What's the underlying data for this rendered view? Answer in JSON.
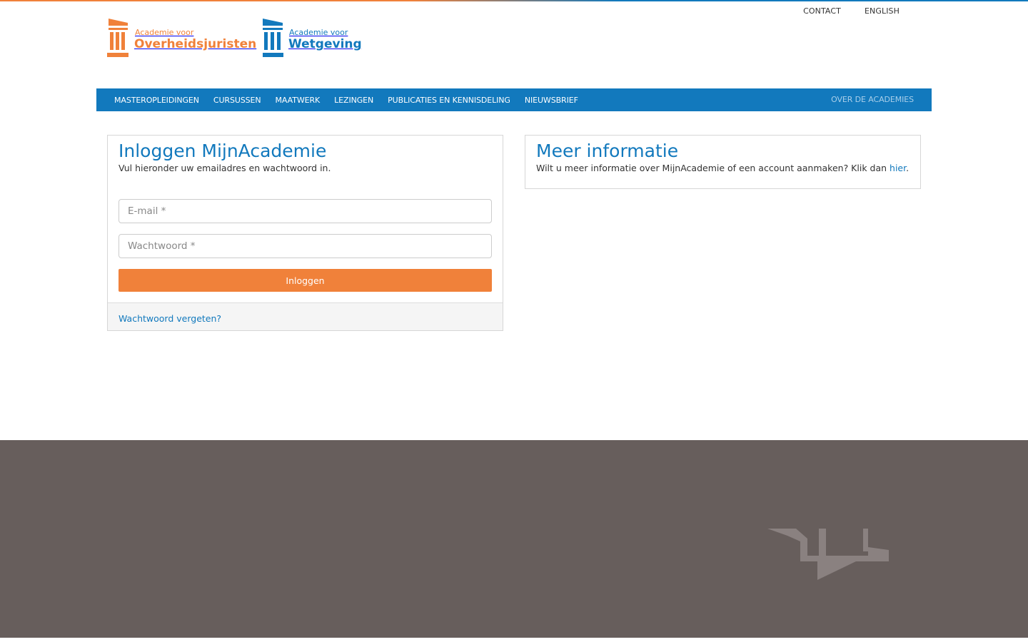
{
  "header": {
    "utility_links": [
      "CONTACT",
      "ENGLISH"
    ],
    "logos": [
      {
        "line1": "Academie voor",
        "line2": "Overheidsjuristen",
        "color": "#f0813a"
      },
      {
        "line1": "Academie voor",
        "line2": "Wetgeving",
        "color": "#1279bd"
      }
    ]
  },
  "nav": {
    "items": [
      "MASTEROPLEIDINGEN",
      "CURSUSSEN",
      "MAATWERK",
      "LEZINGEN",
      "PUBLICATIES EN KENNISDELING",
      "NIEUWSBRIEF"
    ],
    "right": "OVER DE ACADEMIES"
  },
  "login": {
    "title": "Inloggen MijnAcademie",
    "subtitle": "Vul hieronder uw emailadres en wachtwoord in.",
    "email_placeholder": "E-mail *",
    "password_placeholder": "Wachtwoord *",
    "button": "Inloggen",
    "forgot": "Wachtwoord vergeten?"
  },
  "info": {
    "title": "Meer informatie",
    "text": "Wilt u meer informatie over MijnAcademie of een account aanmaken? Klik dan ",
    "link": "hier",
    "suffix": "."
  },
  "colors": {
    "primary_blue": "#1279bd",
    "accent_orange": "#f0813a",
    "footer_bg": "#675e5c"
  }
}
